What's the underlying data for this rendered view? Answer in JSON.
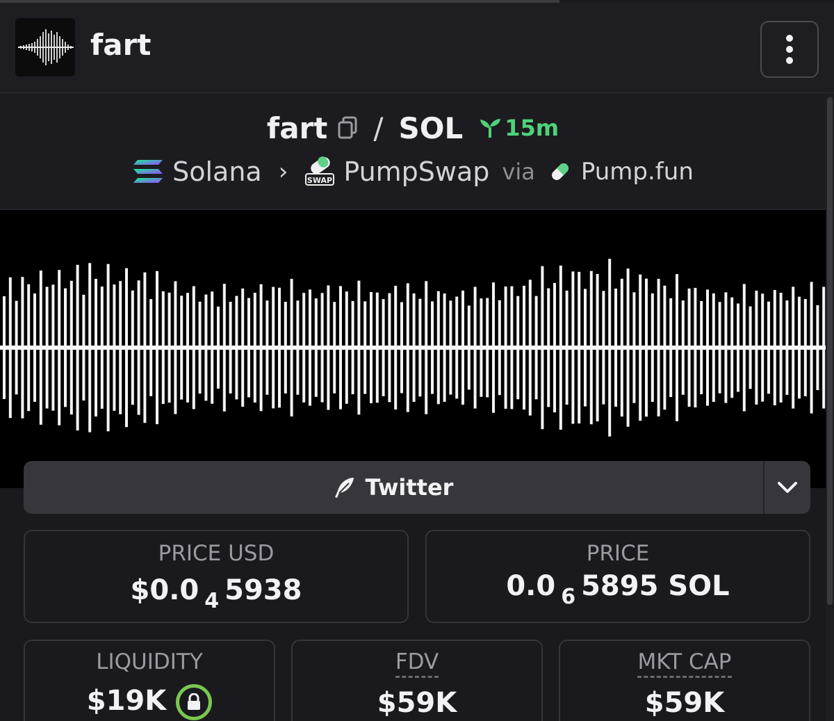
{
  "header": {
    "token_name": "fart",
    "logo_icon": "waveform-icon",
    "menu_icon": "kebab-menu-icon"
  },
  "pair": {
    "base": "fart",
    "quote": "SOL",
    "separator": "/",
    "age": "15m",
    "age_color": "#4fd27a"
  },
  "route": {
    "chain": "Solana",
    "dex": "PumpSwap",
    "dex_badge": "SWAP",
    "via_label": "via",
    "launchpad": "Pump.fun"
  },
  "social": {
    "twitter_label": "Twitter"
  },
  "stats": {
    "price_usd": {
      "label": "PRICE USD",
      "prefix": "$0.0",
      "zeros": "4",
      "digits": "5938"
    },
    "price_native": {
      "label": "PRICE",
      "prefix": "0.0",
      "zeros": "6",
      "digits": "5895 SOL"
    },
    "liquidity": {
      "label": "LIQUIDITY",
      "value": "$19K",
      "lock_color": "#7ac74f"
    },
    "fdv": {
      "label": "FDV",
      "value": "$59K"
    },
    "mkt_cap": {
      "label": "MKT CAP",
      "value": "$59K"
    }
  }
}
